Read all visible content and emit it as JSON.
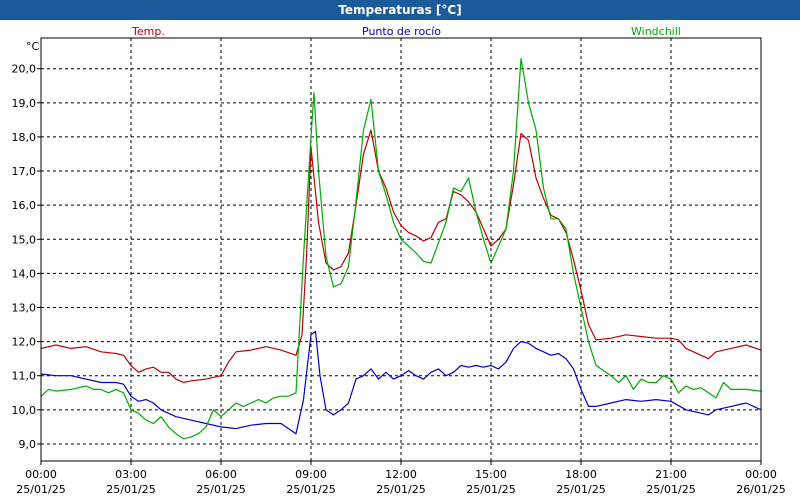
{
  "window": {
    "title": "Temperaturas [°C]"
  },
  "colors": {
    "titlebar": "#1c5b9a",
    "temp": "#c00000",
    "dew": "#0000c8",
    "windchill": "#00aa00",
    "grid": "#000000"
  },
  "chart_data": {
    "type": "line",
    "title": "Temperaturas [°C]",
    "ylabel": "°C",
    "ylim": [
      8.5,
      20.9
    ],
    "xlim_hours": [
      0,
      24
    ],
    "grid": true,
    "legend_placement": "top",
    "y_ticks": [
      "9,0",
      "10,0",
      "11,0",
      "12,0",
      "13,0",
      "14,0",
      "15,0",
      "16,0",
      "17,0",
      "18,0",
      "19,0",
      "20,0"
    ],
    "x_ticks": [
      {
        "time": "00:00",
        "date": "25/01/25"
      },
      {
        "time": "03:00",
        "date": "25/01/25"
      },
      {
        "time": "06:00",
        "date": "25/01/25"
      },
      {
        "time": "09:00",
        "date": "25/01/25"
      },
      {
        "time": "12:00",
        "date": "25/01/25"
      },
      {
        "time": "15:00",
        "date": "25/01/25"
      },
      {
        "time": "18:00",
        "date": "25/01/25"
      },
      {
        "time": "21:00",
        "date": "25/01/25"
      },
      {
        "time": "00:00",
        "date": "26/01/25"
      }
    ],
    "series": [
      {
        "name": "Temp.",
        "color": "#c00000",
        "points": [
          [
            0,
            11.8
          ],
          [
            0.5,
            11.9
          ],
          [
            1,
            11.8
          ],
          [
            1.5,
            11.85
          ],
          [
            2,
            11.7
          ],
          [
            2.5,
            11.65
          ],
          [
            2.75,
            11.6
          ],
          [
            3,
            11.3
          ],
          [
            3.25,
            11.1
          ],
          [
            3.5,
            11.2
          ],
          [
            3.75,
            11.25
          ],
          [
            4,
            11.1
          ],
          [
            4.25,
            11.1
          ],
          [
            4.5,
            10.9
          ],
          [
            4.75,
            10.8
          ],
          [
            5,
            10.85
          ],
          [
            5.5,
            10.9
          ],
          [
            6,
            11.0
          ],
          [
            6.25,
            11.4
          ],
          [
            6.5,
            11.7
          ],
          [
            7,
            11.75
          ],
          [
            7.5,
            11.85
          ],
          [
            8,
            11.75
          ],
          [
            8.5,
            11.6
          ],
          [
            8.7,
            12.2
          ],
          [
            8.85,
            14.5
          ],
          [
            9.0,
            17.7
          ],
          [
            9.25,
            15.5
          ],
          [
            9.5,
            14.3
          ],
          [
            9.75,
            14.1
          ],
          [
            10,
            14.2
          ],
          [
            10.25,
            14.6
          ],
          [
            10.5,
            16.0
          ],
          [
            10.75,
            17.5
          ],
          [
            11.0,
            18.2
          ],
          [
            11.25,
            17.0
          ],
          [
            11.5,
            16.5
          ],
          [
            11.75,
            15.8
          ],
          [
            12,
            15.4
          ],
          [
            12.25,
            15.2
          ],
          [
            12.5,
            15.1
          ],
          [
            12.75,
            14.95
          ],
          [
            13,
            15.05
          ],
          [
            13.25,
            15.5
          ],
          [
            13.5,
            15.6
          ],
          [
            13.75,
            16.4
          ],
          [
            14,
            16.3
          ],
          [
            14.25,
            16.1
          ],
          [
            14.5,
            15.8
          ],
          [
            14.75,
            15.3
          ],
          [
            15,
            14.8
          ],
          [
            15.25,
            15.0
          ],
          [
            15.5,
            15.3
          ],
          [
            15.75,
            16.6
          ],
          [
            16,
            18.1
          ],
          [
            16.25,
            17.9
          ],
          [
            16.5,
            16.8
          ],
          [
            16.75,
            16.2
          ],
          [
            17,
            15.7
          ],
          [
            17.25,
            15.6
          ],
          [
            17.5,
            15.2
          ],
          [
            17.75,
            14.4
          ],
          [
            18,
            13.5
          ],
          [
            18.25,
            12.5
          ],
          [
            18.5,
            12.05
          ],
          [
            19,
            12.1
          ],
          [
            19.5,
            12.2
          ],
          [
            20,
            12.15
          ],
          [
            20.5,
            12.1
          ],
          [
            21,
            12.1
          ],
          [
            21.25,
            12.05
          ],
          [
            21.5,
            11.8
          ],
          [
            22,
            11.6
          ],
          [
            22.25,
            11.5
          ],
          [
            22.5,
            11.7
          ],
          [
            23,
            11.8
          ],
          [
            23.5,
            11.9
          ],
          [
            24,
            11.75
          ]
        ]
      },
      {
        "name": "Punto de rocío",
        "color": "#0000c8",
        "points": [
          [
            0,
            11.05
          ],
          [
            0.5,
            11.0
          ],
          [
            1,
            11.0
          ],
          [
            1.5,
            10.9
          ],
          [
            2,
            10.8
          ],
          [
            2.5,
            10.8
          ],
          [
            2.75,
            10.75
          ],
          [
            3,
            10.4
          ],
          [
            3.25,
            10.25
          ],
          [
            3.5,
            10.3
          ],
          [
            3.75,
            10.2
          ],
          [
            4,
            10.0
          ],
          [
            4.5,
            9.8
          ],
          [
            5,
            9.7
          ],
          [
            5.5,
            9.6
          ],
          [
            6,
            9.5
          ],
          [
            6.5,
            9.45
          ],
          [
            7,
            9.55
          ],
          [
            7.5,
            9.6
          ],
          [
            8,
            9.6
          ],
          [
            8.5,
            9.3
          ],
          [
            8.75,
            10.3
          ],
          [
            9,
            12.2
          ],
          [
            9.15,
            12.3
          ],
          [
            9.3,
            11.0
          ],
          [
            9.5,
            10.0
          ],
          [
            9.75,
            9.85
          ],
          [
            10,
            10.0
          ],
          [
            10.25,
            10.2
          ],
          [
            10.5,
            10.9
          ],
          [
            10.75,
            11.0
          ],
          [
            11,
            11.2
          ],
          [
            11.25,
            10.9
          ],
          [
            11.5,
            11.1
          ],
          [
            11.75,
            10.9
          ],
          [
            12,
            11.0
          ],
          [
            12.25,
            11.15
          ],
          [
            12.5,
            11.0
          ],
          [
            12.75,
            10.9
          ],
          [
            13,
            11.1
          ],
          [
            13.25,
            11.2
          ],
          [
            13.5,
            11.0
          ],
          [
            13.75,
            11.1
          ],
          [
            14,
            11.3
          ],
          [
            14.25,
            11.25
          ],
          [
            14.5,
            11.3
          ],
          [
            14.75,
            11.25
          ],
          [
            15,
            11.3
          ],
          [
            15.25,
            11.2
          ],
          [
            15.5,
            11.4
          ],
          [
            15.75,
            11.8
          ],
          [
            16,
            12.0
          ],
          [
            16.25,
            11.95
          ],
          [
            16.5,
            11.8
          ],
          [
            16.75,
            11.7
          ],
          [
            17,
            11.6
          ],
          [
            17.25,
            11.65
          ],
          [
            17.5,
            11.5
          ],
          [
            17.75,
            11.2
          ],
          [
            18,
            10.6
          ],
          [
            18.25,
            10.1
          ],
          [
            18.5,
            10.1
          ],
          [
            19,
            10.2
          ],
          [
            19.5,
            10.3
          ],
          [
            20,
            10.25
          ],
          [
            20.5,
            10.3
          ],
          [
            21,
            10.25
          ],
          [
            21.5,
            10.0
          ],
          [
            22,
            9.9
          ],
          [
            22.25,
            9.85
          ],
          [
            22.5,
            10.0
          ],
          [
            23,
            10.1
          ],
          [
            23.5,
            10.2
          ],
          [
            24,
            10.0
          ]
        ]
      },
      {
        "name": "Windchill",
        "color": "#00aa00",
        "points": [
          [
            0,
            10.4
          ],
          [
            0.25,
            10.6
          ],
          [
            0.5,
            10.55
          ],
          [
            1,
            10.6
          ],
          [
            1.25,
            10.65
          ],
          [
            1.5,
            10.7
          ],
          [
            1.75,
            10.6
          ],
          [
            2,
            10.6
          ],
          [
            2.25,
            10.5
          ],
          [
            2.5,
            10.6
          ],
          [
            2.75,
            10.5
          ],
          [
            3,
            10.0
          ],
          [
            3.25,
            9.9
          ],
          [
            3.5,
            9.7
          ],
          [
            3.75,
            9.6
          ],
          [
            4,
            9.8
          ],
          [
            4.25,
            9.5
          ],
          [
            4.5,
            9.3
          ],
          [
            4.75,
            9.15
          ],
          [
            5,
            9.2
          ],
          [
            5.25,
            9.3
          ],
          [
            5.5,
            9.5
          ],
          [
            5.75,
            10.0
          ],
          [
            6,
            9.8
          ],
          [
            6.25,
            10.0
          ],
          [
            6.5,
            10.2
          ],
          [
            6.75,
            10.1
          ],
          [
            7,
            10.2
          ],
          [
            7.25,
            10.3
          ],
          [
            7.5,
            10.2
          ],
          [
            7.75,
            10.35
          ],
          [
            8,
            10.4
          ],
          [
            8.25,
            10.4
          ],
          [
            8.5,
            10.5
          ],
          [
            8.75,
            14.5
          ],
          [
            9.0,
            18.0
          ],
          [
            9.1,
            19.3
          ],
          [
            9.25,
            17.0
          ],
          [
            9.5,
            14.5
          ],
          [
            9.75,
            13.6
          ],
          [
            10,
            13.7
          ],
          [
            10.25,
            14.2
          ],
          [
            10.5,
            16.1
          ],
          [
            10.75,
            18.2
          ],
          [
            11,
            19.1
          ],
          [
            11.25,
            17.0
          ],
          [
            11.5,
            16.3
          ],
          [
            11.75,
            15.5
          ],
          [
            12,
            15.0
          ],
          [
            12.25,
            14.8
          ],
          [
            12.5,
            14.6
          ],
          [
            12.75,
            14.35
          ],
          [
            13,
            14.3
          ],
          [
            13.25,
            14.9
          ],
          [
            13.5,
            15.5
          ],
          [
            13.75,
            16.5
          ],
          [
            14,
            16.4
          ],
          [
            14.25,
            16.8
          ],
          [
            14.5,
            15.8
          ],
          [
            14.75,
            15.0
          ],
          [
            15,
            14.3
          ],
          [
            15.25,
            14.8
          ],
          [
            15.5,
            15.3
          ],
          [
            15.75,
            17.0
          ],
          [
            16.0,
            20.3
          ],
          [
            16.25,
            19.0
          ],
          [
            16.5,
            18.2
          ],
          [
            16.75,
            16.5
          ],
          [
            17,
            15.6
          ],
          [
            17.25,
            15.6
          ],
          [
            17.5,
            15.3
          ],
          [
            17.75,
            14.0
          ],
          [
            18,
            13.0
          ],
          [
            18.25,
            12.0
          ],
          [
            18.5,
            11.3
          ],
          [
            19,
            11.0
          ],
          [
            19.25,
            10.8
          ],
          [
            19.5,
            11.0
          ],
          [
            19.75,
            10.6
          ],
          [
            20,
            10.9
          ],
          [
            20.25,
            10.8
          ],
          [
            20.5,
            10.8
          ],
          [
            20.75,
            11.0
          ],
          [
            21,
            10.9
          ],
          [
            21.25,
            10.5
          ],
          [
            21.5,
            10.7
          ],
          [
            21.75,
            10.6
          ],
          [
            22,
            10.65
          ],
          [
            22.25,
            10.5
          ],
          [
            22.5,
            10.35
          ],
          [
            22.75,
            10.8
          ],
          [
            23,
            10.6
          ],
          [
            23.5,
            10.6
          ],
          [
            24,
            10.55
          ]
        ]
      }
    ]
  }
}
